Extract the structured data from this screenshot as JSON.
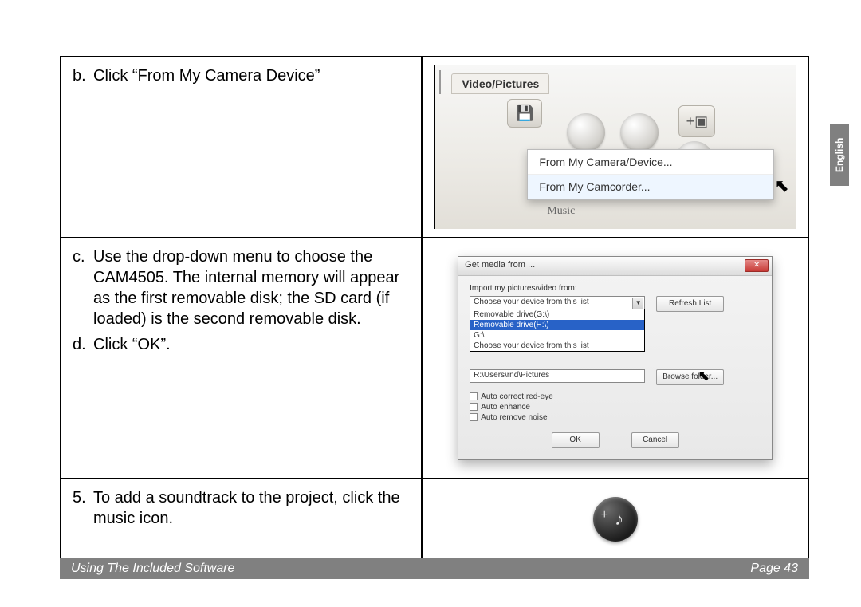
{
  "rows": {
    "b": {
      "marker": "b.",
      "text": "Click “From My Camera Device”"
    },
    "c": {
      "marker": "c.",
      "text": "Use the drop-down menu to choose the CAM4505. The internal memory will appear as the first removable disk; the SD card (if loaded) is the second removable disk."
    },
    "d": {
      "marker": "d.",
      "text": "Click “OK”."
    },
    "five": {
      "marker": "5.",
      "text": "To add a soundtrack to the project, click the music icon."
    }
  },
  "screenshot_b": {
    "tab_label": "Video/Pictures",
    "menu_item_1": "From My Camera/Device...",
    "menu_item_2": "From My Camcorder...",
    "music_label": "Music"
  },
  "screenshot_c": {
    "dialog_title": "Get media from ...",
    "import_label": "Import my pictures/video from:",
    "combo_selected": "Choose your device from this list",
    "combo_options": [
      "Removable drive(G:\\)",
      "Removable drive(H:\\)",
      "G:\\",
      "Choose your device from this list"
    ],
    "refresh_btn": "Refresh List",
    "path_value": "R:\\Users\\rnd\\Pictures",
    "browse_btn": "Browse folder...",
    "check_1": "Auto correct red-eye",
    "check_2": "Auto enhance",
    "check_3": "Auto remove noise",
    "ok_btn": "OK",
    "cancel_btn": "Cancel"
  },
  "footer": {
    "section": "Using The Included Software",
    "page": "Page 43"
  },
  "side_tab": "English"
}
